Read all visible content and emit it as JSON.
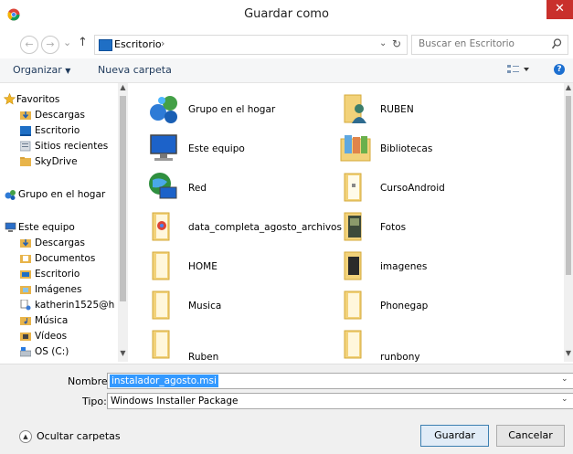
{
  "window": {
    "title": "Guardar como",
    "close_label": "✕"
  },
  "nav": {
    "back_label": "←",
    "forward_label": "→",
    "dropdown_label": "⌄",
    "up_label": "↑",
    "breadcrumb": [
      "Escritorio"
    ],
    "breadcrumb_sep": "›",
    "search_placeholder": "Buscar en Escritorio"
  },
  "toolbar": {
    "organize_label": "Organizar",
    "new_folder_label": "Nueva carpeta"
  },
  "sidebar": {
    "favorites": "Favoritos",
    "favorite_items": [
      "Descargas",
      "Escritorio",
      "Sitios recientes",
      "SkyDrive"
    ],
    "homegroup": "Grupo en el hogar",
    "this_pc": "Este equipo",
    "pc_items": [
      "Descargas",
      "Documentos",
      "Escritorio",
      "Imágenes",
      "katherin1525@h",
      "Música",
      "Vídeos",
      "OS (C:)"
    ]
  },
  "content": {
    "left_column": [
      "Grupo en el hogar",
      "Este equipo",
      "Red",
      "data_completa_agosto_archivos",
      "HOME",
      "Musica",
      "Ruben"
    ],
    "right_column": [
      "RUBEN",
      "Bibliotecas",
      "CursoAndroid",
      "Fotos",
      "imagenes",
      "Phonegap",
      "runbony"
    ]
  },
  "form": {
    "name_label": "Nombre:",
    "name_value": "instalador_agosto.msi",
    "type_label": "Tipo:",
    "type_value": "Windows Installer Package"
  },
  "footer": {
    "hide_folders_label": "Ocultar carpetas",
    "save_label": "Guardar",
    "cancel_label": "Cancelar"
  }
}
